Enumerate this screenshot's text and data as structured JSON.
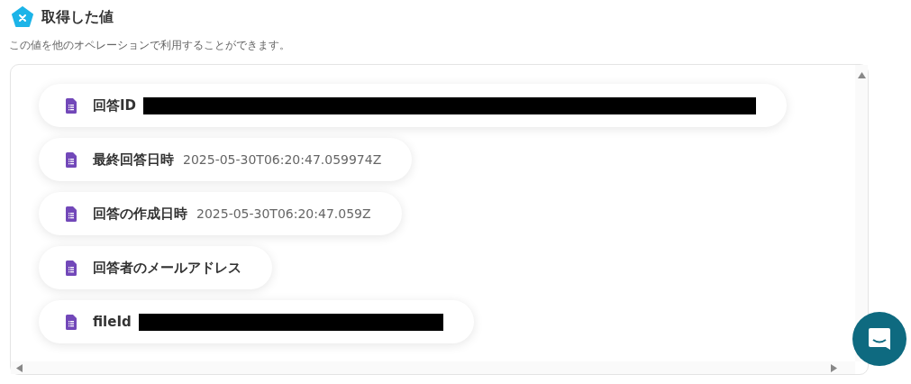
{
  "header": {
    "title": "取得した値",
    "description": "この値を他のオペレーションで利用することができます。"
  },
  "items": [
    {
      "label": "回答ID",
      "kind": "redacted"
    },
    {
      "label": "最終回答日時",
      "kind": "text",
      "value": "2025-05-30T06:20:47.059974Z"
    },
    {
      "label": "回答の作成日時",
      "kind": "text",
      "value": "2025-05-30T06:20:47.059Z"
    },
    {
      "label": "回答者のメールアドレス",
      "kind": "empty"
    },
    {
      "label": "fileId",
      "kind": "redacted"
    }
  ]
}
